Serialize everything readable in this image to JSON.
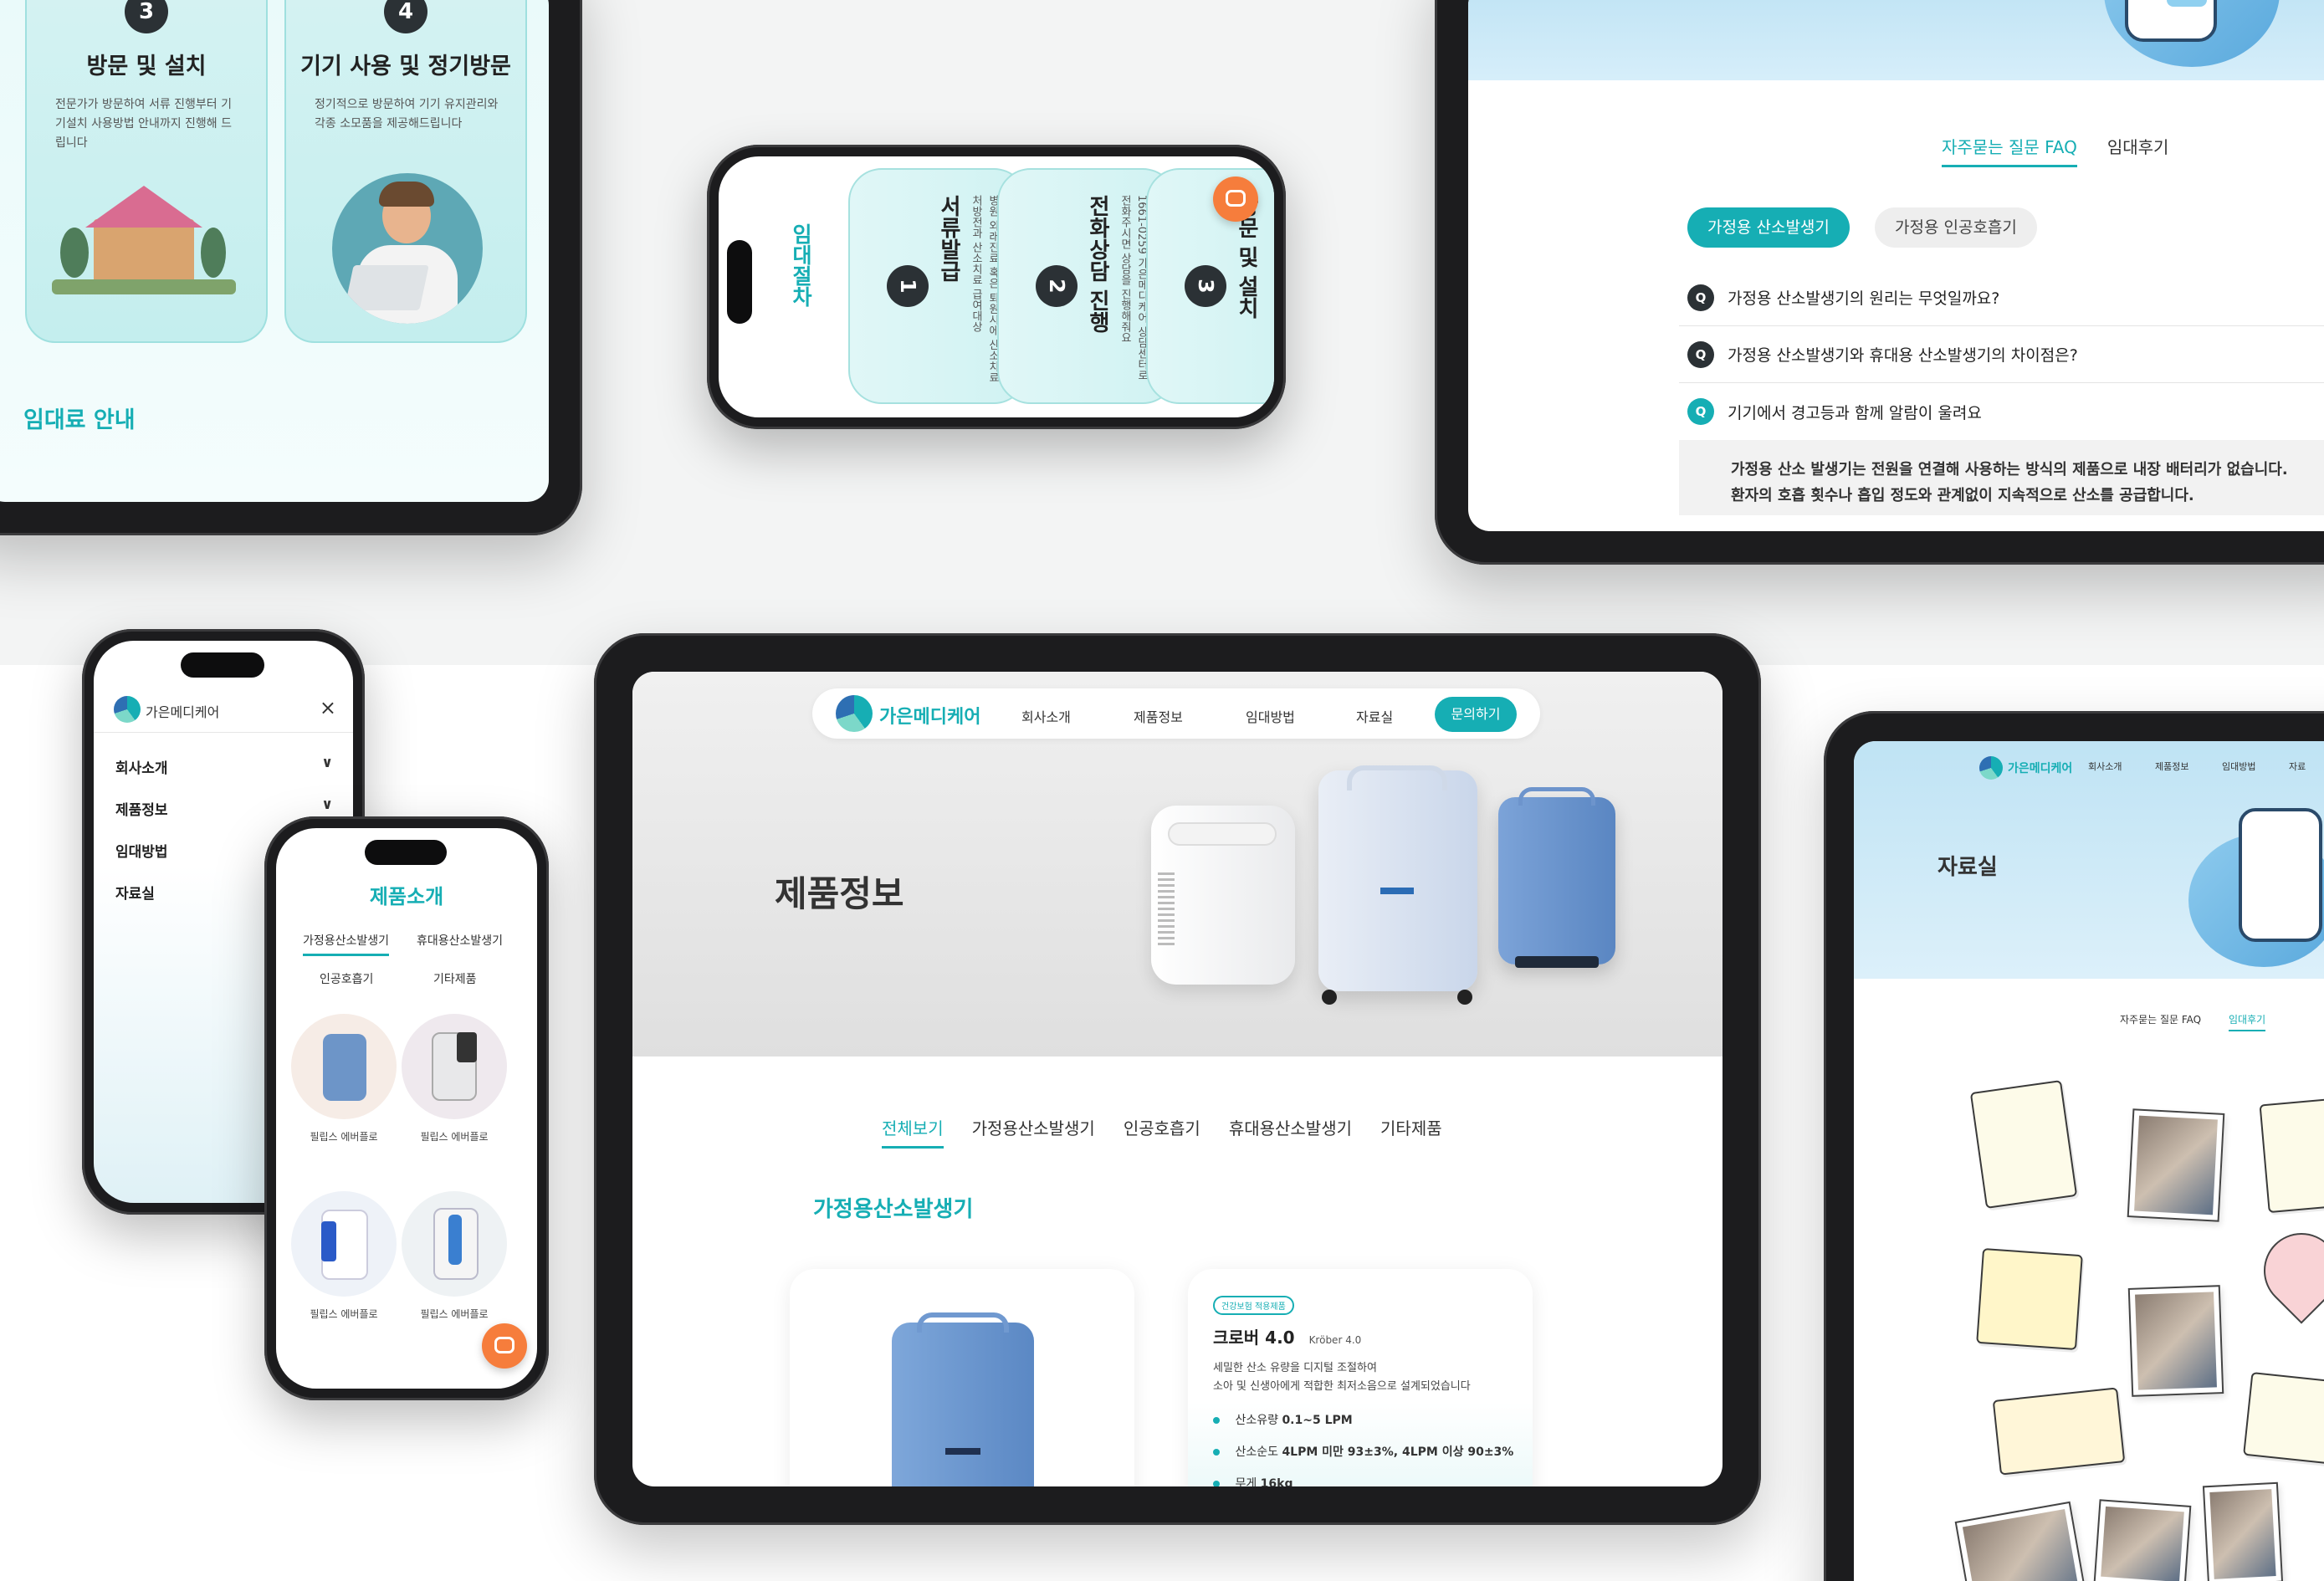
{
  "brand": {
    "name": "가은메디케어",
    "accent": "#16aeb4",
    "cta_color": "#f67d3c"
  },
  "rental_steps_tablet": {
    "steps": [
      {
        "num": "3",
        "title": "방문 및 설치",
        "desc": "전문가가 방문하여 서류 진행부터 기기설치 사용방법 안내까지 진행해 드립니다"
      },
      {
        "num": "4",
        "title": "기기 사용 및 정기방문",
        "desc": "정기적으로 방문하여 기기 유지관리와 각종 소모품을 제공해드립니다"
      }
    ],
    "next_section": "임대료 안내"
  },
  "landscape_phone": {
    "section_label": "임대절차",
    "steps": [
      {
        "num": "1",
        "title": "서류발급",
        "desc": "병원 외래진료 혹은 퇴원시에 산소치료 처방전과 산소치료 급여대상"
      },
      {
        "num": "2",
        "title": "전화상담 진행",
        "desc": "1661-0259 가은메디케어 상담센터로 전화주시면 상담을 진행해줘요"
      },
      {
        "num": "3",
        "title": "방문 및 설치",
        "desc": ""
      }
    ],
    "chat_icon": "chat-bubble-icon"
  },
  "faq_tablet": {
    "tabs": [
      {
        "label": "자주묻는 질문 FAQ",
        "active": true
      },
      {
        "label": "임대후기",
        "active": false
      }
    ],
    "pills": [
      {
        "label": "가정용 산소발생기",
        "active": true
      },
      {
        "label": "가정용 인공호흡기",
        "active": false
      }
    ],
    "questions": [
      {
        "badge": "Q",
        "text": "가정용 산소발생기의 원리는 무엇일까요?"
      },
      {
        "badge": "Q",
        "text": "가정용 산소발생기와 휴대용 산소발생기의 차이점은?"
      },
      {
        "badge": "Q",
        "text": "기기에서 경고등과 함께 알람이 울려요"
      }
    ],
    "answer_lines": [
      "가정용 산소 발생기는 전원을 연결해 사용하는 방식의 제품으로 내장 배터리가 없습니다.",
      "환자의 호흡 횟수나 흡입 정도와 관계없이 지속적으로 산소를 공급합니다."
    ]
  },
  "menu_phone": {
    "logo_text": "가은메디케어",
    "close_label": "×",
    "items": [
      {
        "label": "회사소개",
        "chevron": "∨"
      },
      {
        "label": "제품정보",
        "chevron": "∨"
      },
      {
        "label": "임대방법",
        "chevron": ""
      },
      {
        "label": "자료실",
        "chevron": ""
      }
    ]
  },
  "products_phone": {
    "title": "제품소개",
    "tabs": [
      "가정용산소발생기",
      "휴대용산소발생기",
      "인공호흡기",
      "기타제품"
    ],
    "products": [
      "필립스 에버플로",
      "필립스 에버플로",
      "필립스 에버플로",
      "필립스 에버플로"
    ]
  },
  "main_tablet": {
    "nav": {
      "links": [
        "회사소개",
        "제품정보",
        "임대방법",
        "자료실"
      ],
      "cta": "문의하기"
    },
    "hero_title": "제품정보",
    "categories": [
      {
        "label": "전체보기",
        "active": true
      },
      {
        "label": "가정용산소발생기",
        "active": false
      },
      {
        "label": "인공호흡기",
        "active": false
      },
      {
        "label": "휴대용산소발생기",
        "active": false
      },
      {
        "label": "기타제품",
        "active": false
      }
    ],
    "section_title": "가정용산소발생기",
    "spec_card": {
      "badge": "건강보험 적용제품",
      "name": "크로버 4.0",
      "model": "Kröber 4.0",
      "desc_lines": [
        "세밀한 산소 유량을 디지털 조절하여",
        "소아 및 신생아에게 적합한 최저소음으로 설계되었습니다"
      ],
      "specs": [
        {
          "label": "산소유량",
          "value": "0.1~5 LPM"
        },
        {
          "label": "산소순도",
          "value": "4LPM 미만 93±3%, 4LPM 이상 90±3%"
        },
        {
          "label": "무게",
          "value": "16kg"
        }
      ]
    }
  },
  "archive_tablet": {
    "nav_links": [
      "회사소개",
      "제품정보",
      "임대방법",
      "자료"
    ],
    "hero_title": "자료실",
    "tabs": [
      {
        "label": "자주묻는 질문 FAQ",
        "active": false
      },
      {
        "label": "임대후기",
        "active": true
      }
    ]
  }
}
